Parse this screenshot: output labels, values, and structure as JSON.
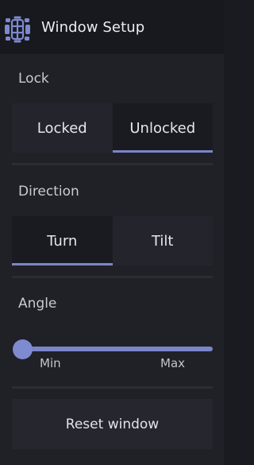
{
  "header": {
    "title": "Window Setup",
    "icon": "window-grid-icon"
  },
  "lock": {
    "label": "Lock",
    "options": [
      "Locked",
      "Unlocked"
    ],
    "selected": "Unlocked"
  },
  "direction": {
    "label": "Direction",
    "options": [
      "Turn",
      "Tilt"
    ],
    "selected": "Turn"
  },
  "angle": {
    "label": "Angle",
    "min_label": "Min",
    "max_label": "Max",
    "value_fraction": 0.0
  },
  "reset": {
    "label": "Reset window"
  },
  "colors": {
    "accent": "#7a86c9",
    "background": "#202127",
    "header_background": "#18191e"
  }
}
